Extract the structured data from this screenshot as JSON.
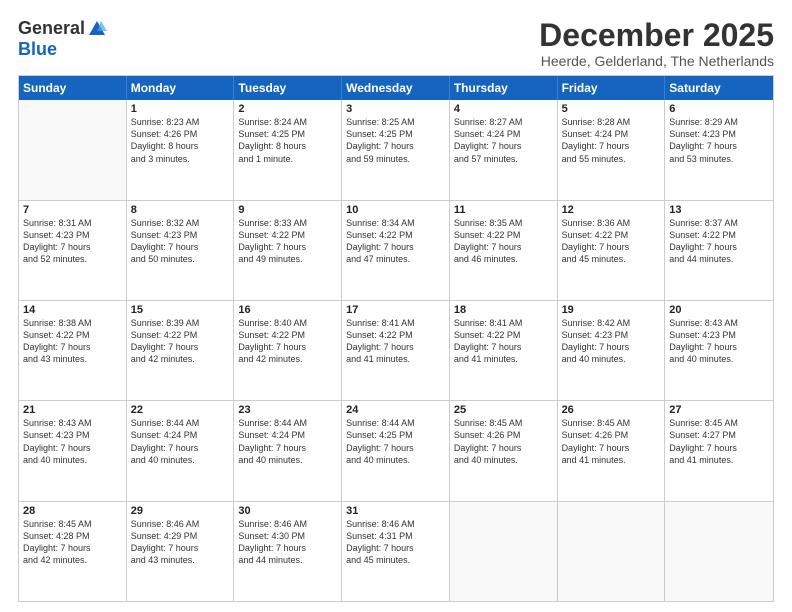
{
  "logo": {
    "general": "General",
    "blue": "Blue"
  },
  "header": {
    "month": "December 2025",
    "location": "Heerde, Gelderland, The Netherlands"
  },
  "days": [
    "Sunday",
    "Monday",
    "Tuesday",
    "Wednesday",
    "Thursday",
    "Friday",
    "Saturday"
  ],
  "weeks": [
    [
      {
        "day": "",
        "content": ""
      },
      {
        "day": "1",
        "content": "Sunrise: 8:23 AM\nSunset: 4:26 PM\nDaylight: 8 hours\nand 3 minutes."
      },
      {
        "day": "2",
        "content": "Sunrise: 8:24 AM\nSunset: 4:25 PM\nDaylight: 8 hours\nand 1 minute."
      },
      {
        "day": "3",
        "content": "Sunrise: 8:25 AM\nSunset: 4:25 PM\nDaylight: 7 hours\nand 59 minutes."
      },
      {
        "day": "4",
        "content": "Sunrise: 8:27 AM\nSunset: 4:24 PM\nDaylight: 7 hours\nand 57 minutes."
      },
      {
        "day": "5",
        "content": "Sunrise: 8:28 AM\nSunset: 4:24 PM\nDaylight: 7 hours\nand 55 minutes."
      },
      {
        "day": "6",
        "content": "Sunrise: 8:29 AM\nSunset: 4:23 PM\nDaylight: 7 hours\nand 53 minutes."
      }
    ],
    [
      {
        "day": "7",
        "content": "Sunrise: 8:31 AM\nSunset: 4:23 PM\nDaylight: 7 hours\nand 52 minutes."
      },
      {
        "day": "8",
        "content": "Sunrise: 8:32 AM\nSunset: 4:23 PM\nDaylight: 7 hours\nand 50 minutes."
      },
      {
        "day": "9",
        "content": "Sunrise: 8:33 AM\nSunset: 4:22 PM\nDaylight: 7 hours\nand 49 minutes."
      },
      {
        "day": "10",
        "content": "Sunrise: 8:34 AM\nSunset: 4:22 PM\nDaylight: 7 hours\nand 47 minutes."
      },
      {
        "day": "11",
        "content": "Sunrise: 8:35 AM\nSunset: 4:22 PM\nDaylight: 7 hours\nand 46 minutes."
      },
      {
        "day": "12",
        "content": "Sunrise: 8:36 AM\nSunset: 4:22 PM\nDaylight: 7 hours\nand 45 minutes."
      },
      {
        "day": "13",
        "content": "Sunrise: 8:37 AM\nSunset: 4:22 PM\nDaylight: 7 hours\nand 44 minutes."
      }
    ],
    [
      {
        "day": "14",
        "content": "Sunrise: 8:38 AM\nSunset: 4:22 PM\nDaylight: 7 hours\nand 43 minutes."
      },
      {
        "day": "15",
        "content": "Sunrise: 8:39 AM\nSunset: 4:22 PM\nDaylight: 7 hours\nand 42 minutes."
      },
      {
        "day": "16",
        "content": "Sunrise: 8:40 AM\nSunset: 4:22 PM\nDaylight: 7 hours\nand 42 minutes."
      },
      {
        "day": "17",
        "content": "Sunrise: 8:41 AM\nSunset: 4:22 PM\nDaylight: 7 hours\nand 41 minutes."
      },
      {
        "day": "18",
        "content": "Sunrise: 8:41 AM\nSunset: 4:22 PM\nDaylight: 7 hours\nand 41 minutes."
      },
      {
        "day": "19",
        "content": "Sunrise: 8:42 AM\nSunset: 4:23 PM\nDaylight: 7 hours\nand 40 minutes."
      },
      {
        "day": "20",
        "content": "Sunrise: 8:43 AM\nSunset: 4:23 PM\nDaylight: 7 hours\nand 40 minutes."
      }
    ],
    [
      {
        "day": "21",
        "content": "Sunrise: 8:43 AM\nSunset: 4:23 PM\nDaylight: 7 hours\nand 40 minutes."
      },
      {
        "day": "22",
        "content": "Sunrise: 8:44 AM\nSunset: 4:24 PM\nDaylight: 7 hours\nand 40 minutes."
      },
      {
        "day": "23",
        "content": "Sunrise: 8:44 AM\nSunset: 4:24 PM\nDaylight: 7 hours\nand 40 minutes."
      },
      {
        "day": "24",
        "content": "Sunrise: 8:44 AM\nSunset: 4:25 PM\nDaylight: 7 hours\nand 40 minutes."
      },
      {
        "day": "25",
        "content": "Sunrise: 8:45 AM\nSunset: 4:26 PM\nDaylight: 7 hours\nand 40 minutes."
      },
      {
        "day": "26",
        "content": "Sunrise: 8:45 AM\nSunset: 4:26 PM\nDaylight: 7 hours\nand 41 minutes."
      },
      {
        "day": "27",
        "content": "Sunrise: 8:45 AM\nSunset: 4:27 PM\nDaylight: 7 hours\nand 41 minutes."
      }
    ],
    [
      {
        "day": "28",
        "content": "Sunrise: 8:45 AM\nSunset: 4:28 PM\nDaylight: 7 hours\nand 42 minutes."
      },
      {
        "day": "29",
        "content": "Sunrise: 8:46 AM\nSunset: 4:29 PM\nDaylight: 7 hours\nand 43 minutes."
      },
      {
        "day": "30",
        "content": "Sunrise: 8:46 AM\nSunset: 4:30 PM\nDaylight: 7 hours\nand 44 minutes."
      },
      {
        "day": "31",
        "content": "Sunrise: 8:46 AM\nSunset: 4:31 PM\nDaylight: 7 hours\nand 45 minutes."
      },
      {
        "day": "",
        "content": ""
      },
      {
        "day": "",
        "content": ""
      },
      {
        "day": "",
        "content": ""
      }
    ]
  ]
}
